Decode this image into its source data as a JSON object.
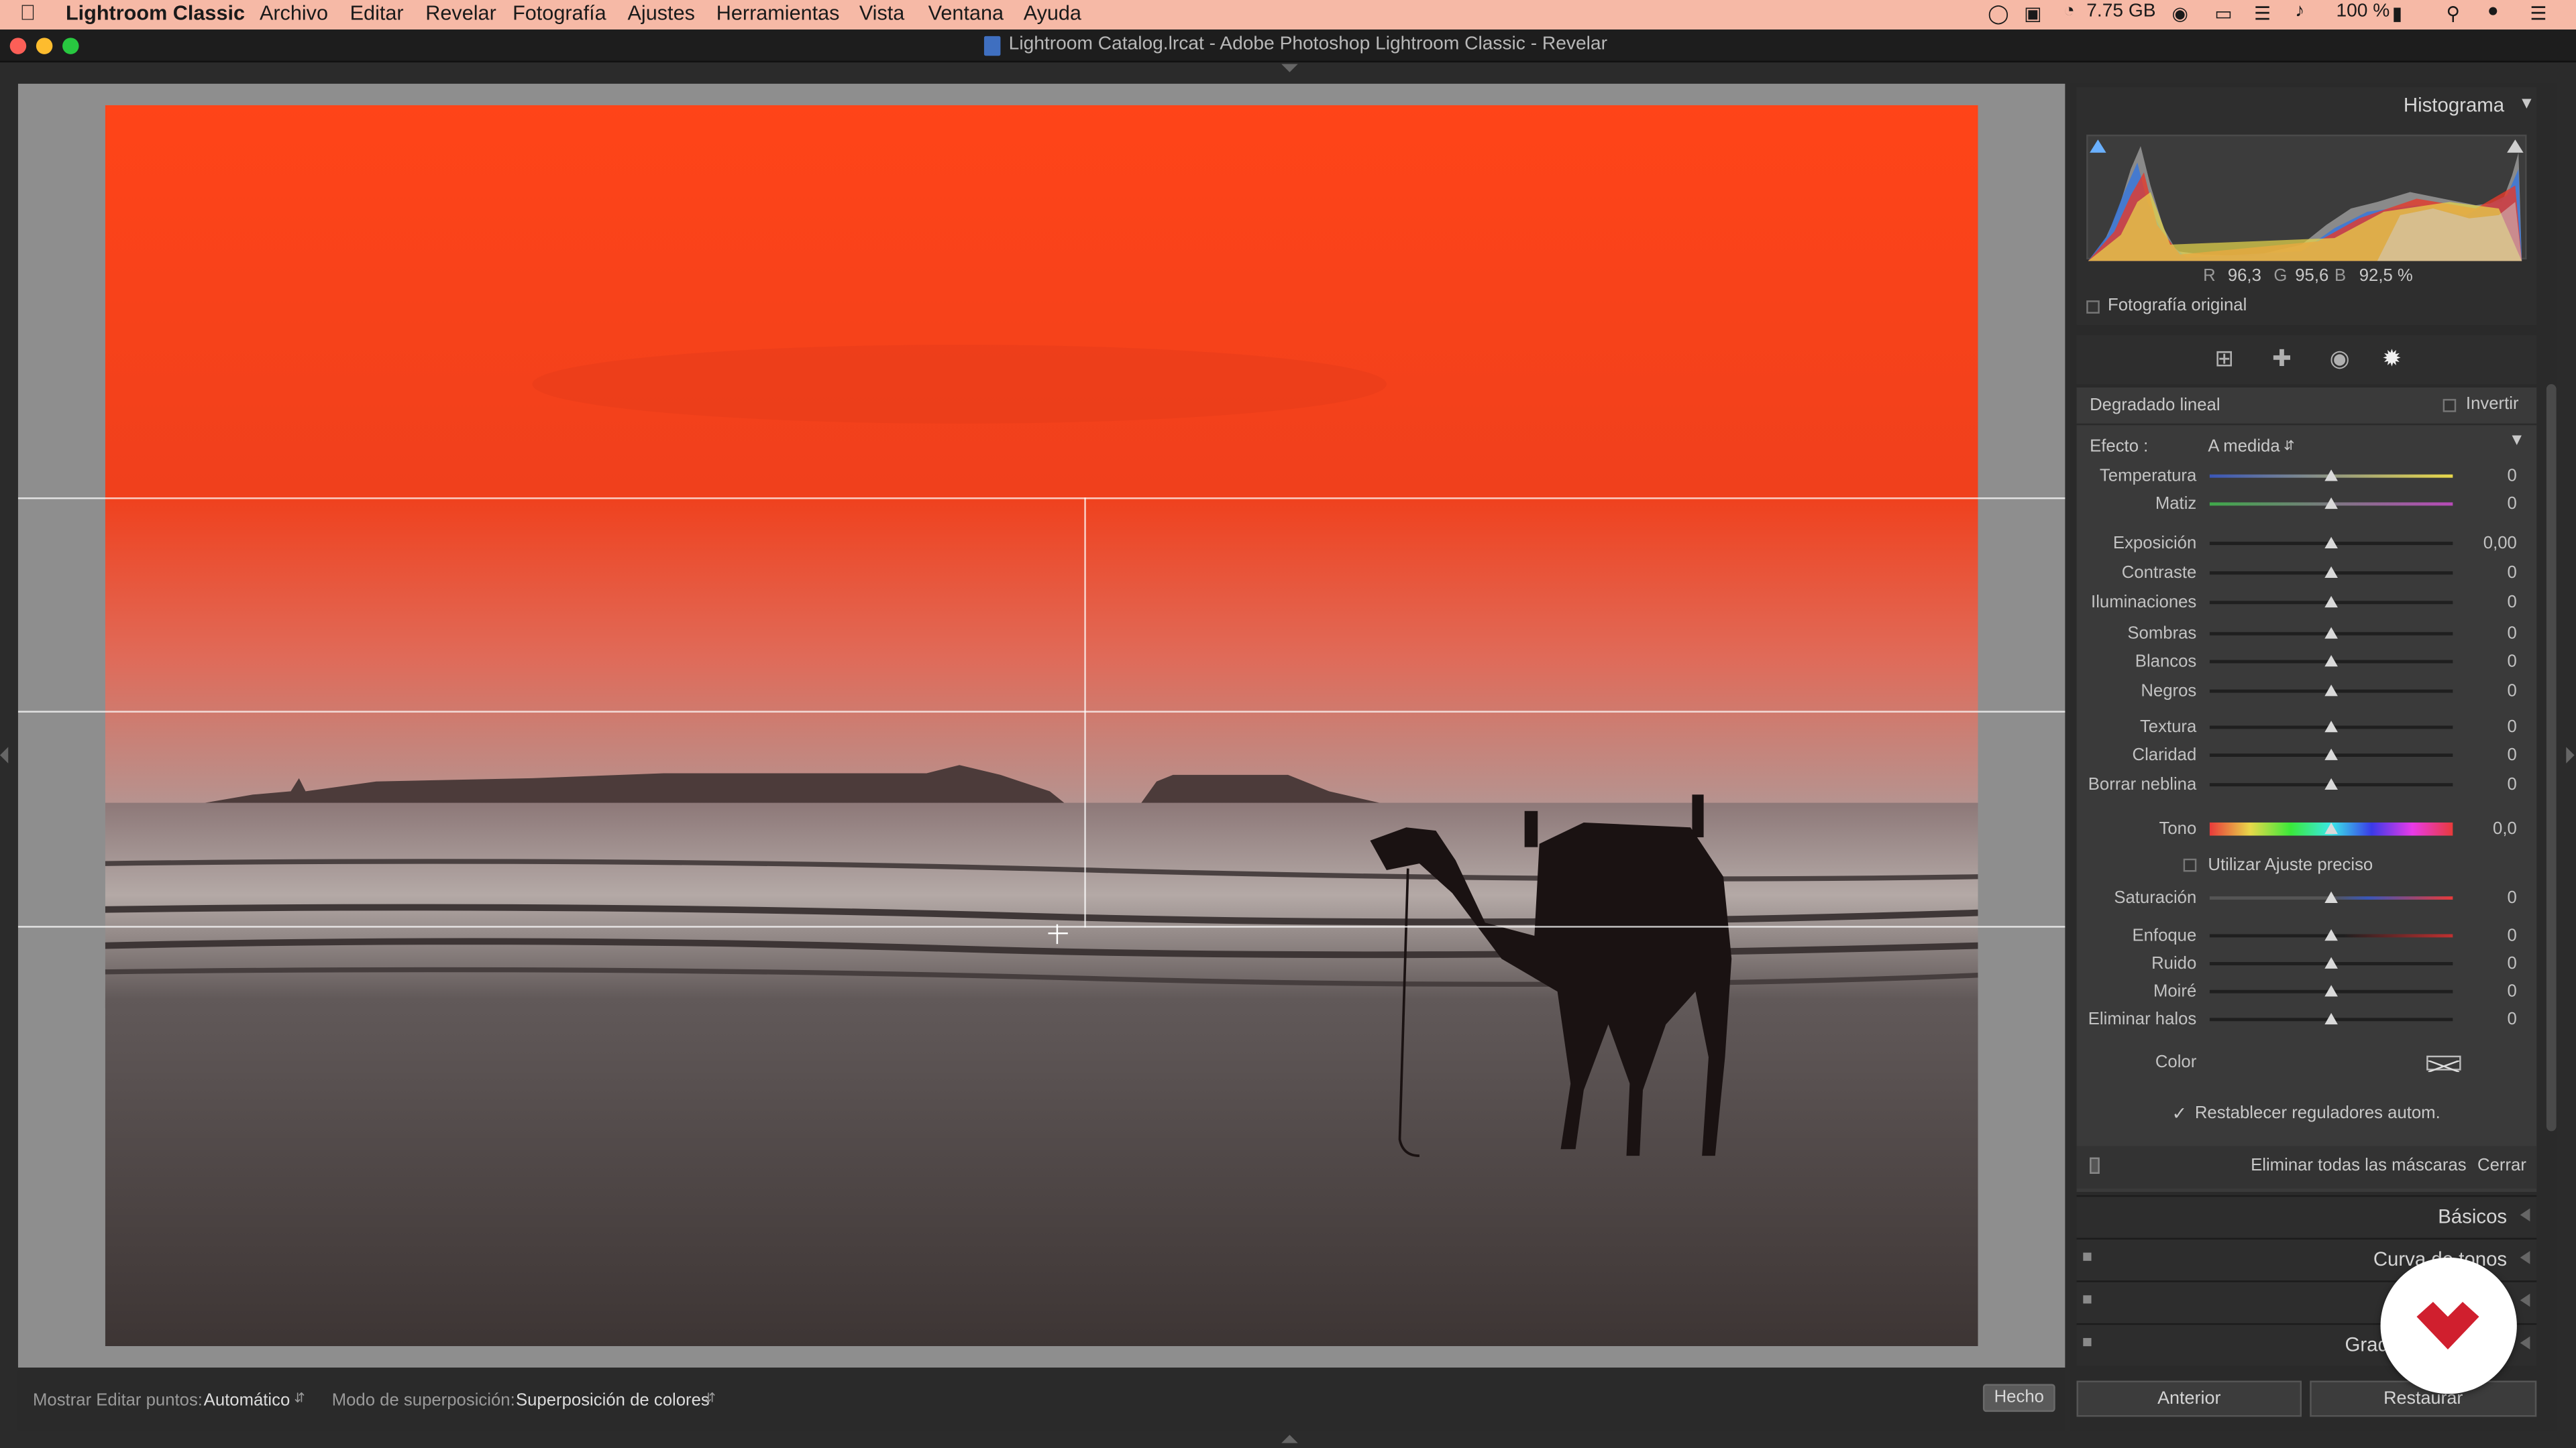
{
  "menubar": {
    "app": "Lightroom Classic",
    "items": [
      "Archivo",
      "Editar",
      "Revelar",
      "Fotografía",
      "Ajustes",
      "Herramientas",
      "Vista",
      "Ventana",
      "Ayuda"
    ],
    "status_storage": "7.75 GB",
    "status_battery": "100 %"
  },
  "window": {
    "title": "Lightroom Catalog.lrcat - Adobe Photoshop Lightroom Classic - Revelar"
  },
  "histogram": {
    "title": "Histograma",
    "r_label": "R",
    "r_value": "96,3",
    "g_label": "G",
    "g_value": "95,6",
    "b_label": "B",
    "b_value": "92,5 %",
    "original_label": "Fotografía original"
  },
  "mask": {
    "type_label": "Degradado lineal",
    "invert_label": "Invertir",
    "effect_label": "Efecto :",
    "effect_value": "A medida",
    "sliders": [
      {
        "label": "Temperatura",
        "value": "0",
        "level": 0.5
      },
      {
        "label": "Matiz",
        "value": "0",
        "level": 0.5
      },
      {
        "label": "Exposición",
        "value": "0,00",
        "level": 0.5
      },
      {
        "label": "Contraste",
        "value": "0",
        "level": 0.5
      },
      {
        "label": "Iluminaciones",
        "value": "0",
        "level": 0.5
      },
      {
        "label": "Sombras",
        "value": "0",
        "level": 0.5
      },
      {
        "label": "Blancos",
        "value": "0",
        "level": 0.5
      },
      {
        "label": "Negros",
        "value": "0",
        "level": 0.5
      },
      {
        "label": "Textura",
        "value": "0",
        "level": 0.5
      },
      {
        "label": "Claridad",
        "value": "0",
        "level": 0.5
      },
      {
        "label": "Borrar neblina",
        "value": "0",
        "level": 0.5
      },
      {
        "label": "Tono",
        "value": "0,0",
        "level": 0.5
      },
      {
        "label": "Saturación",
        "value": "0",
        "level": 0.5
      },
      {
        "label": "Enfoque",
        "value": "0",
        "level": 0.5
      },
      {
        "label": "Ruido",
        "value": "0",
        "level": 0.5
      },
      {
        "label": "Moiré",
        "value": "0",
        "level": 0.5
      },
      {
        "label": "Eliminar halos",
        "value": "0",
        "level": 0.5
      }
    ],
    "fine_adjust_label": "Utilizar Ajuste preciso",
    "color_label": "Color",
    "auto_reset_label": "Restablecer reguladores autom.",
    "delete_all_label": "Eliminar todas las máscaras",
    "close_label": "Cerrar"
  },
  "panels": [
    "Básicos",
    "Curva de tonos",
    "",
    "Grad"
  ],
  "toolbar": {
    "show_points_label": "Mostrar Editar puntos:",
    "show_points_value": "Automático",
    "overlay_label": "Modo de superposición:",
    "overlay_value": "Superposición de colores",
    "done_label": "Hecho"
  },
  "buttons": {
    "previous": "Anterior",
    "reset": "Restaurar"
  },
  "colors": {
    "menubar": "#f6b9a6",
    "overlay": "#ff3b14",
    "panel": "#3a3a3a"
  }
}
